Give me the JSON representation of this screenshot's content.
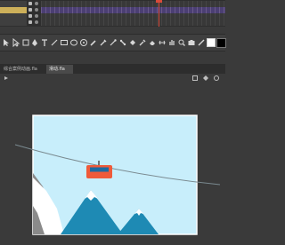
{
  "timeline": {
    "layers": [
      {
        "selected": false
      },
      {
        "selected": true
      },
      {
        "selected": false
      },
      {
        "selected": false
      }
    ]
  },
  "toolbar": {
    "tools": [
      "selection-tool",
      "subselection-tool",
      "free-transform-tool",
      "lasso-tool",
      "pen-tool",
      "text-tool",
      "line-tool",
      "rectangle-tool",
      "oval-tool",
      "polystar-tool",
      "pencil-tool",
      "brush-tool",
      "paint-brush-tool",
      "bone-tool",
      "paint-bucket-tool",
      "eyedropper-tool",
      "eraser-tool",
      "width-tool",
      "hand-tool",
      "zoom-tool",
      "camera-tool"
    ],
    "stroke_color": "#ffffff",
    "fill_color": "#000000"
  },
  "tabs": [
    {
      "label": "综合案例动画.fla",
      "active": false
    },
    {
      "label": "滑动.fla",
      "active": true
    }
  ],
  "stage": {
    "sky_color": "#c8eefb",
    "cable_color": "#7a8a90",
    "gondola_color": "#ef5a3a",
    "gondola_window_color": "#1e6aa0",
    "mountain_color": "#1e8ab4",
    "snow_color": "#ffffff",
    "rock_color": "#8a8a8a"
  }
}
